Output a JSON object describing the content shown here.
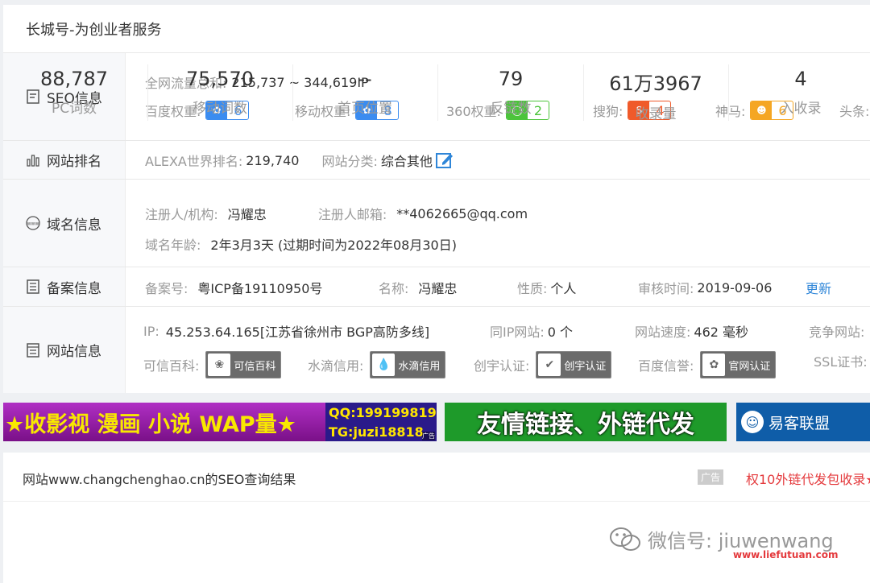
{
  "header": {
    "title": "长城号-为创业者服务"
  },
  "seo": {
    "label": "SEO信息",
    "traffic_label": "全网流量总和:",
    "traffic_value": "215,737 ~ 344,619IP",
    "ranks": [
      {
        "label": "百度权重:",
        "value": "6",
        "color": "#3b8cf0"
      },
      {
        "label": "移动权重:",
        "value": "8",
        "color": "#3b8cf0"
      },
      {
        "label": "360权重:",
        "value": "2",
        "color": "#4cc43b"
      },
      {
        "label": "搜狗:",
        "value": "4",
        "color": "#f05a2a"
      },
      {
        "label": "神马:",
        "value": "6",
        "color": "#f5a623"
      }
    ],
    "more": "头条:"
  },
  "rank": {
    "label": "网站排名",
    "alexa_label": "ALEXA世界排名:",
    "alexa_value": "219,740",
    "cat_label": "网站分类:",
    "cat_value": "综合其他"
  },
  "domain": {
    "label": "域名信息",
    "reg_label": "注册人/机构:",
    "reg_value": "冯耀忠",
    "email_label": "注册人邮箱:",
    "email_value": "**4062665@qq.com",
    "age_label": "域名年龄:",
    "age_value": "2年3月3天 (过期时间为2022年08月30日)"
  },
  "icp": {
    "label": "备案信息",
    "no_label": "备案号:",
    "no_value": "粤ICP备19110950号",
    "name_label": "名称:",
    "name_value": "冯耀忠",
    "type_label": "性质:",
    "type_value": "个人",
    "time_label": "审核时间:",
    "time_value": "2019-09-06",
    "update": "更新"
  },
  "site": {
    "label": "网站信息",
    "ip_label": "IP:",
    "ip_value": "45.253.64.165[江苏省徐州市 BGP高防多线]",
    "sameip_label": "同IP网站:",
    "sameip_value": "0 个",
    "speed_label": "网站速度:",
    "speed_value": "462 毫秒",
    "compete_label": "竞争网站:",
    "certs": [
      {
        "label": "可信百科:",
        "badge": "可信百科"
      },
      {
        "label": "水滴信用:",
        "badge": "水滴信用"
      },
      {
        "label": "创宇认证:",
        "badge": "创宇认证"
      },
      {
        "label": "百度信誉:",
        "badge": "官网认证"
      }
    ],
    "ssl_label": "SSL证书:"
  },
  "banners": {
    "b1_text": "★收影视 漫画 小说 WAP量★",
    "b1_qq": "QQ:199199819",
    "b1_tg": "TG:juzi18818",
    "b1_ad": "广告",
    "b2_text": "友情链接、外链代发",
    "b3_text": "易客联盟"
  },
  "result": {
    "title": "网站www.changchenghao.cn的SEO查询结果",
    "ad_tag": "广告",
    "ad_text": "权10外链代发包收录★",
    "stats": [
      {
        "num": "88,787",
        "label": "PC词数"
      },
      {
        "num": "75,570",
        "label": "移动词数"
      },
      {
        "num": "--",
        "label": "首页位置"
      },
      {
        "num": "79",
        "label": "反链数"
      },
      {
        "num": "61万3967",
        "label": "收录量"
      },
      {
        "num": "4",
        "label": "入收录"
      }
    ]
  },
  "watermark": {
    "text": "微信号: jiuwenwang",
    "url": "www.liefutuan.com"
  }
}
